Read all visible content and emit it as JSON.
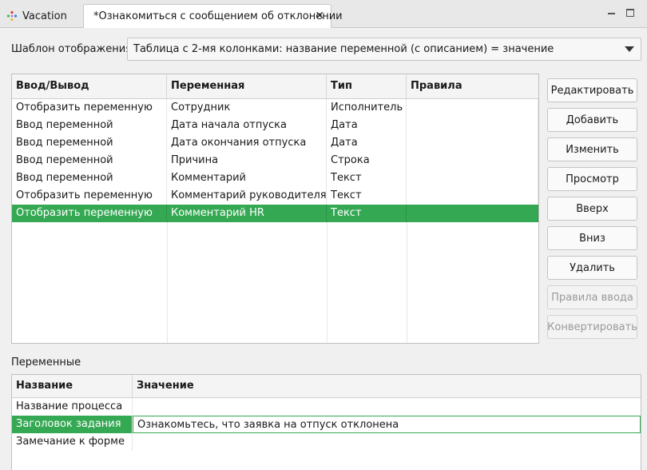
{
  "tabs": [
    {
      "label": "Vacation",
      "icon": "process-icon"
    },
    {
      "label": "*Ознакомиться с сообщением об отклонении",
      "icon": "form-icon"
    }
  ],
  "template": {
    "label": "Шаблон отображения",
    "selected": "Таблица с 2-мя колонками: название переменной (с описанием) = значение"
  },
  "main_table": {
    "headers": [
      "Ввод/Вывод",
      "Переменная",
      "Тип",
      "Правила"
    ],
    "rows": [
      {
        "io": "Отобразить переменную",
        "var": "Сотрудник",
        "type": "Исполнитель",
        "rules": ""
      },
      {
        "io": "Ввод переменной",
        "var": "Дата начала отпуска",
        "type": "Дата",
        "rules": ""
      },
      {
        "io": "Ввод переменной",
        "var": "Дата окончания отпуска",
        "type": "Дата",
        "rules": ""
      },
      {
        "io": "Ввод переменной",
        "var": "Причина",
        "type": "Строка",
        "rules": ""
      },
      {
        "io": "Ввод переменной",
        "var": "Комментарий",
        "type": "Текст",
        "rules": ""
      },
      {
        "io": "Отобразить переменную",
        "var": "Комментарий руководителя",
        "type": "Текст",
        "rules": ""
      },
      {
        "io": "Отобразить переменную",
        "var": "Комментарий HR",
        "type": "Текст",
        "rules": ""
      }
    ],
    "selected_row": 6
  },
  "buttons": {
    "edit": "Редактировать",
    "add": "Добавить",
    "change": "Изменить",
    "view": "Просмотр",
    "up": "Вверх",
    "down": "Вниз",
    "delete": "Удалить",
    "input_rules": "Правила ввода",
    "convert": "Конвертировать"
  },
  "variables": {
    "label": "Переменные",
    "headers": [
      "Название",
      "Значение"
    ],
    "rows": [
      {
        "name": "Название процесса",
        "value": ""
      },
      {
        "name": "Заголовок задания",
        "value": "Ознакомьтесь, что заявка на отпуск отклонена"
      },
      {
        "name": "Замечание к форме",
        "value": ""
      }
    ],
    "selected_row": 1
  },
  "colors": {
    "selection": "#35a853"
  }
}
